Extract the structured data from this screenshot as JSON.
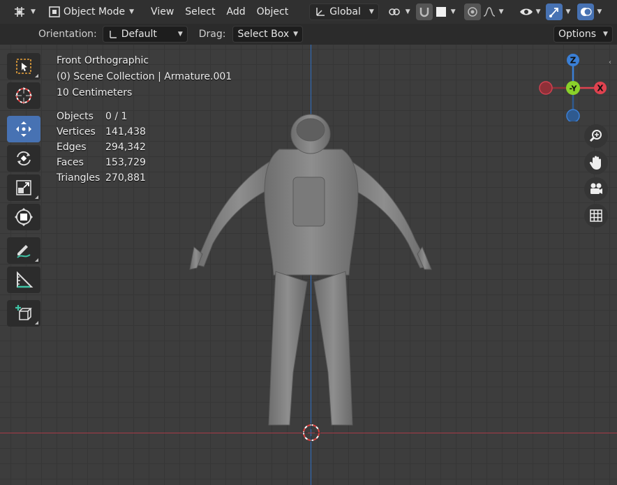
{
  "header": {
    "mode_label": "Object Mode",
    "menus": [
      "View",
      "Select",
      "Add",
      "Object"
    ],
    "transform_orientation": "Global"
  },
  "tool_settings": {
    "orientation_label": "Orientation:",
    "orientation_value": "Default",
    "drag_label": "Drag:",
    "drag_value": "Select Box",
    "options_label": "Options"
  },
  "overlay": {
    "view_name": "Front Orthographic",
    "collection": "(0) Scene Collection | Armature.001",
    "grid_scale": "10 Centimeters"
  },
  "stats": [
    {
      "label": "Objects",
      "value": "0 / 1"
    },
    {
      "label": "Vertices",
      "value": "141,438"
    },
    {
      "label": "Edges",
      "value": "294,342"
    },
    {
      "label": "Faces",
      "value": "153,729"
    },
    {
      "label": "Triangles",
      "value": "270,881"
    }
  ],
  "gizmo": {
    "z": "Z",
    "y": "-Y",
    "x": "X"
  },
  "colors": {
    "accent": "#4772b3",
    "x_axis": "#e0424f",
    "y_axis": "#8ad12a",
    "z_axis": "#3a7fd6"
  },
  "tools": [
    "select-box-icon",
    "cursor-icon",
    "move-icon",
    "rotate-icon",
    "scale-icon",
    "transform-icon",
    "annotate-icon",
    "measure-icon",
    "add-cube-icon"
  ]
}
